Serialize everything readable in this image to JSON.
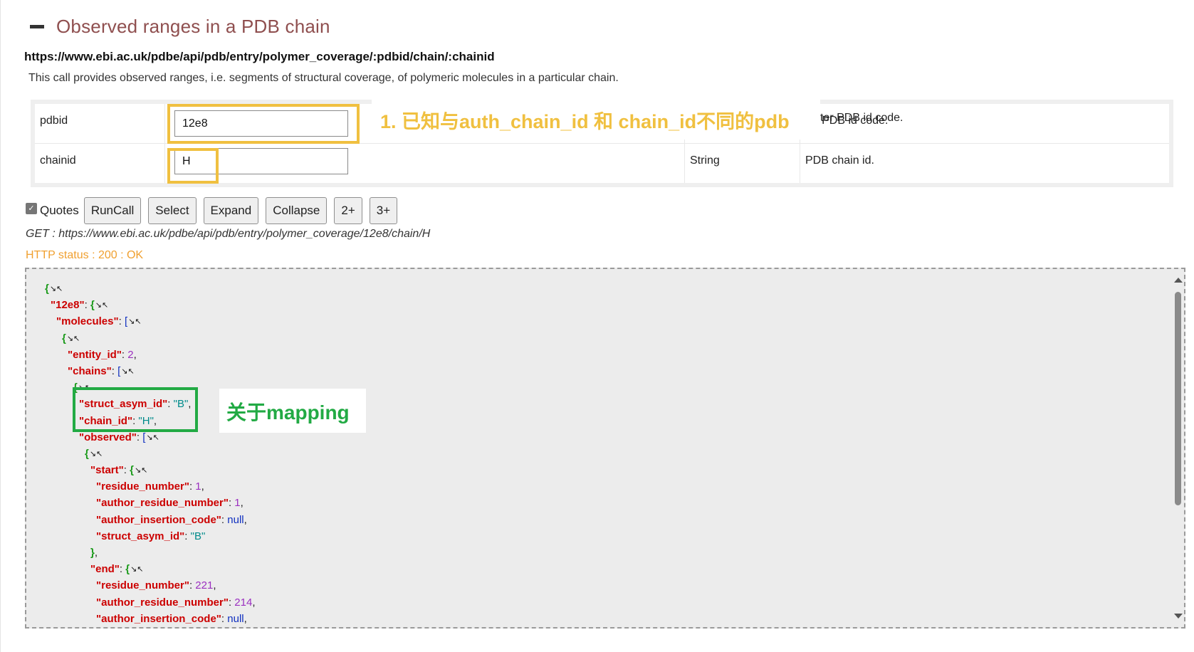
{
  "section": {
    "title": "Observed ranges in a PDB chain",
    "endpoint": "https://www.ebi.ac.uk/pdbe/api/pdb/entry/polymer_coverage/:pdbid/chain/:chainid",
    "description": "This call provides observed ranges, i.e. segments of structural coverage, of polymeric molecules in a particular chain."
  },
  "params": [
    {
      "name": "pdbid",
      "value": "12e8",
      "type": "",
      "desc": "ter PDB id code."
    },
    {
      "name": "chainid",
      "value": "H",
      "type": "String",
      "desc": "PDB chain id."
    }
  ],
  "annotations": {
    "yellow": "1. 已知与auth_chain_id 和 chain_id不同的pdb",
    "green": "关于mapping"
  },
  "toolbar": {
    "quotes_label": "Quotes",
    "quotes_checked": true,
    "buttons": [
      "RunCall",
      "Select",
      "Expand",
      "Collapse",
      "2+",
      "3+"
    ]
  },
  "request": {
    "get_line": "GET : https://www.ebi.ac.uk/pdbe/api/pdb/entry/polymer_coverage/12e8/chain/H",
    "http_status": "HTTP status : 200 : OK"
  },
  "json_keys": {
    "pdb": "\"12e8\"",
    "molecules": "\"molecules\"",
    "entity_id": "\"entity_id\"",
    "chains": "\"chains\"",
    "struct_asym_id": "\"struct_asym_id\"",
    "chain_id": "\"chain_id\"",
    "observed": "\"observed\"",
    "start": "\"start\"",
    "end": "\"end\"",
    "residue_number": "\"residue_number\"",
    "author_residue_number": "\"author_residue_number\"",
    "author_insertion_code": "\"author_insertion_code\""
  },
  "json_values": {
    "entity_id": "2",
    "struct_asym_id": "\"B\"",
    "chain_id": "\"H\"",
    "start_residue_number": "1",
    "start_author_residue_number": "1",
    "start_author_insertion_code": "null",
    "start_struct_asym_id": "\"B\"",
    "end_residue_number": "221",
    "end_author_residue_number": "214",
    "end_author_insertion_code": "null"
  },
  "colors": {
    "title": "#8f4f4f",
    "status": "#f0a030",
    "json_key": "#cc0000",
    "json_string": "#008b8b",
    "json_number": "#9b30c0",
    "json_null": "#1030c0",
    "json_bracket": "#1a9a1a",
    "highlight_yellow": "#f0c040",
    "highlight_green": "#22aa44"
  },
  "icons": {
    "collapse_toggle": "minus-icon",
    "tree_toggle": "collapse-arrows-icon"
  }
}
